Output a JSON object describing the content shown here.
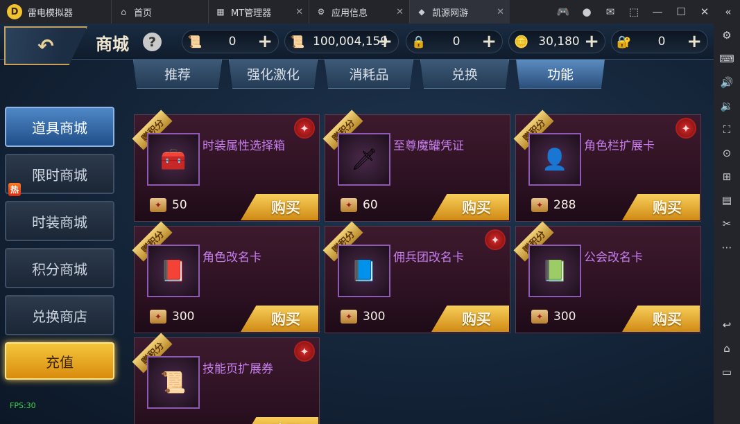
{
  "emulator": {
    "app_title": "雷电模拟器",
    "tabs": [
      {
        "label": "首页",
        "icon": "home-icon"
      },
      {
        "label": "MT管理器",
        "icon": "mt-app-icon"
      },
      {
        "label": "应用信息",
        "icon": "gear-icon"
      },
      {
        "label": "凯源网游",
        "icon": "game-app-icon",
        "active": true
      }
    ],
    "fps": "FPS:30"
  },
  "header": {
    "title": "商城",
    "help": "?",
    "currencies": [
      {
        "icon": "scroll-points-icon",
        "value": "0"
      },
      {
        "icon": "scroll-points-icon",
        "value": "100,004,159"
      },
      {
        "icon": "locked-scroll-icon",
        "value": "0"
      },
      {
        "icon": "gold-coin-icon",
        "value": "30,180"
      },
      {
        "icon": "locked-coin-icon",
        "value": "0"
      }
    ]
  },
  "category_tabs": [
    {
      "label": "推荐"
    },
    {
      "label": "强化激化"
    },
    {
      "label": "消耗品"
    },
    {
      "label": "兑换"
    },
    {
      "label": "功能",
      "active": true
    }
  ],
  "left_menu": [
    {
      "label": "道具商城",
      "active": true
    },
    {
      "label": "限时商城",
      "badge": "热"
    },
    {
      "label": "时装商城"
    },
    {
      "label": "积分商城"
    },
    {
      "label": "兑换商店"
    },
    {
      "label": "充值",
      "recharge": true
    }
  ],
  "items": [
    {
      "name": "时装属性选择箱",
      "price": "50",
      "ribbon": "赠积分",
      "seal": true
    },
    {
      "name": "至尊魔罐凭证",
      "price": "60",
      "ribbon": "赠积分",
      "seal": false
    },
    {
      "name": "角色栏扩展卡",
      "price": "288",
      "ribbon": "赠积分",
      "seal": true
    },
    {
      "name": "角色改名卡",
      "price": "300",
      "ribbon": "赠积分",
      "seal": false
    },
    {
      "name": "佣兵团改名卡",
      "price": "300",
      "ribbon": "赠积分",
      "seal": true
    },
    {
      "name": "公会改名卡",
      "price": "300",
      "ribbon": "赠积分",
      "seal": false
    },
    {
      "name": "技能页扩展券",
      "price": "",
      "ribbon": "赠积分",
      "seal": true
    }
  ],
  "buy_label": "购买"
}
